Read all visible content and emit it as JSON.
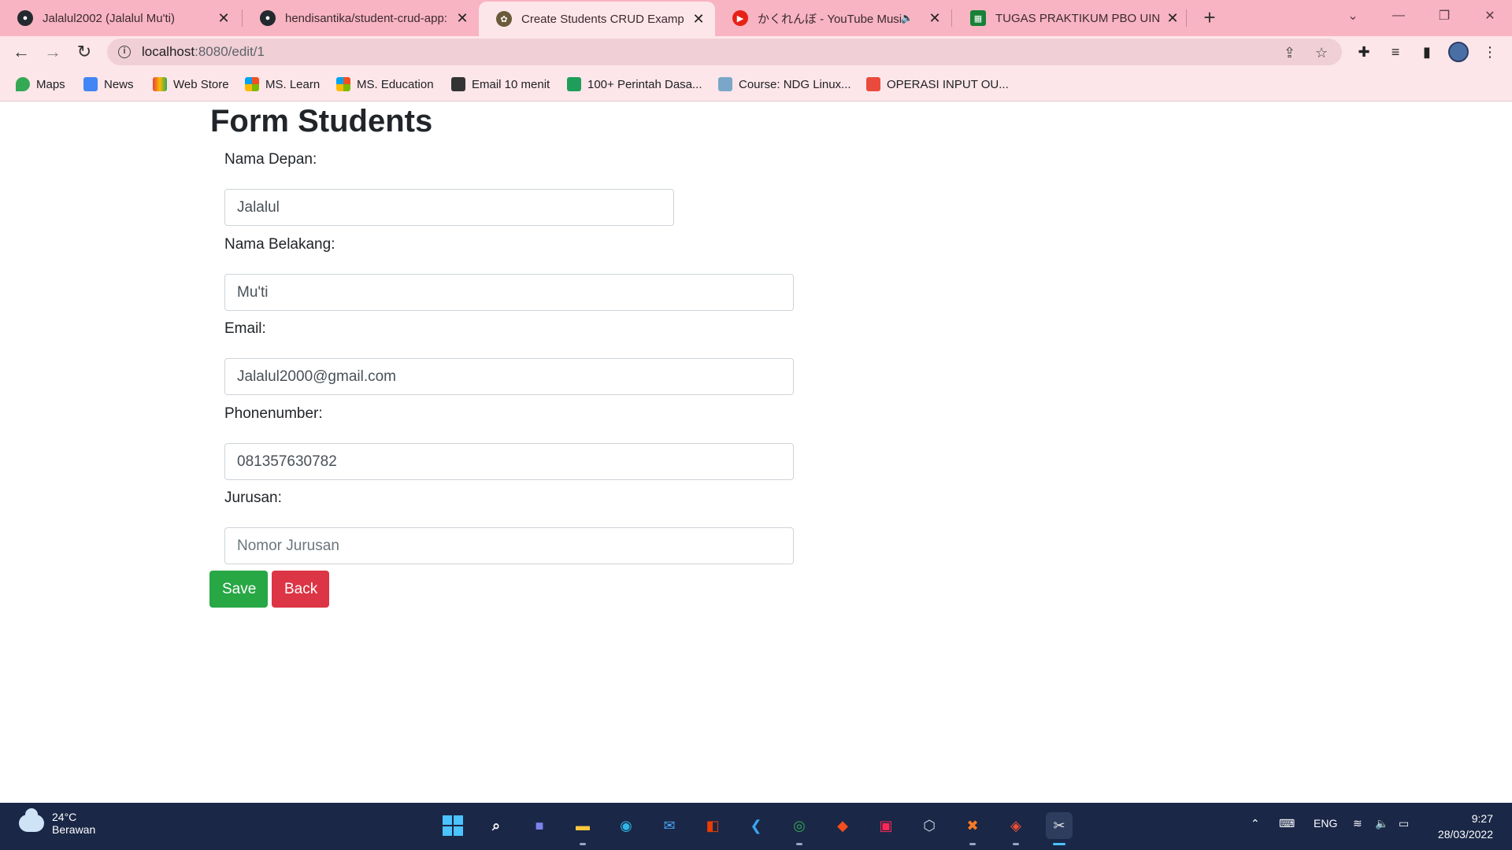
{
  "tabs": [
    {
      "title": "Jalalul2002 (Jalalul Mu'ti)",
      "icon": "github-icon",
      "active": false
    },
    {
      "title": "hendisantika/student-crud-app: C",
      "icon": "github-icon",
      "active": false
    },
    {
      "title": "Create Students CRUD Examp",
      "icon": "app-favicon-icon",
      "active": true
    },
    {
      "title": "かくれんぼ - YouTube Music",
      "icon": "youtube-music-icon",
      "active": false
    },
    {
      "title": "TUGAS PRAKTIKUM PBO UIN SG",
      "icon": "google-sheets-icon",
      "active": false
    }
  ],
  "address": {
    "host": "localhost",
    "path": ":8080/edit/1"
  },
  "bookmarks": [
    {
      "label": "Maps",
      "icon": "maps-icon"
    },
    {
      "label": "News",
      "icon": "news-icon"
    },
    {
      "label": "Web Store",
      "icon": "webstore-icon"
    },
    {
      "label": "MS. Learn",
      "icon": "microsoft-icon"
    },
    {
      "label": "MS. Education",
      "icon": "microsoft-icon"
    },
    {
      "label": "Email 10 menit",
      "icon": "email10-icon"
    },
    {
      "label": "100+ Perintah Dasa...",
      "icon": "bookmark-icon"
    },
    {
      "label": "Course: NDG Linux...",
      "icon": "cisco-icon"
    },
    {
      "label": "OPERASI INPUT OU...",
      "icon": "bookmark-icon"
    }
  ],
  "form": {
    "title": "Form Students",
    "first_name": {
      "label": "Nama Depan:",
      "value": "Jalalul",
      "placeholder": ""
    },
    "last_name": {
      "label": "Nama Belakang:",
      "value": "Mu'ti",
      "placeholder": ""
    },
    "email": {
      "label": "Email:",
      "value": "Jalalul2000@gmail.com",
      "placeholder": ""
    },
    "phone": {
      "label": "Phonenumber:",
      "value": "081357630782",
      "placeholder": ""
    },
    "major": {
      "label": "Jurusan:",
      "value": "",
      "placeholder": "Nomor Jurusan"
    },
    "save_label": "Save",
    "back_label": "Back"
  },
  "taskbar": {
    "weather_temp": "24°C",
    "weather_desc": "Berawan",
    "language": "ENG",
    "time": "9:27",
    "date": "28/03/2022",
    "apps": [
      "start-icon",
      "search-icon",
      "teams-chat-icon",
      "file-explorer-icon",
      "edge-icon",
      "mail-icon",
      "office-icon",
      "vscode-icon",
      "chrome-icon",
      "figma-icon",
      "intellij-icon",
      "virtualbox-icon",
      "xampp-icon",
      "git-icon",
      "snipping-tool-icon"
    ]
  },
  "colors": {
    "save": "#28a745",
    "back": "#dc3545",
    "chrome_tint": "#f8b4c2"
  }
}
